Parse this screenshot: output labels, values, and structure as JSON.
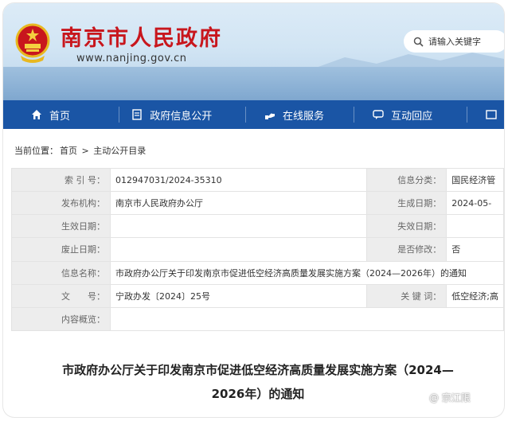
{
  "header": {
    "title": "南京市人民政府",
    "url": "www.nanjing.gov.cn",
    "search_placeholder": "请输入关键字"
  },
  "nav": {
    "items": [
      {
        "label": "首页",
        "icon": "home-icon"
      },
      {
        "label": "政府信息公开",
        "icon": "document-icon"
      },
      {
        "label": "在线服务",
        "icon": "service-icon"
      },
      {
        "label": "互动回应",
        "icon": "chat-icon"
      }
    ]
  },
  "breadcrumb": {
    "prefix": "当前位置：",
    "home": "首页",
    "sep": ">",
    "current": "主动公开目录"
  },
  "info": {
    "index_label": "索 引 号：",
    "index_value": "012947031/2024-35310",
    "category_label": "信息分类：",
    "category_value": "国民经济管",
    "publisher_label": "发布机构：",
    "publisher_value": "南京市人民政府办公厅",
    "created_label": "生成日期：",
    "created_value": "2024-05-",
    "effective_label": "生效日期：",
    "effective_value": "",
    "expire_label": "失效日期：",
    "expire_value": "",
    "abolish_label": "废止日期：",
    "abolish_value": "",
    "modified_label": "是否修改：",
    "modified_value": "否",
    "name_label": "信息名称：",
    "name_value": "市政府办公厅关于印发南京市促进低空经济高质量发展实施方案（2024—2026年）的通知",
    "docno_label": "文　　号：",
    "docno_value": "宁政办发〔2024〕25号",
    "keywords_label": "关 键 词：",
    "keywords_value": "低空经济;高",
    "summary_label": "内容概览：",
    "summary_value": ""
  },
  "document": {
    "title_line1": "市政府办公厅关于印发南京市促进低空经济高质量发展实施方案（2024—",
    "title_line2": "2026年）的通知"
  },
  "watermark": "@ 宗江限"
}
